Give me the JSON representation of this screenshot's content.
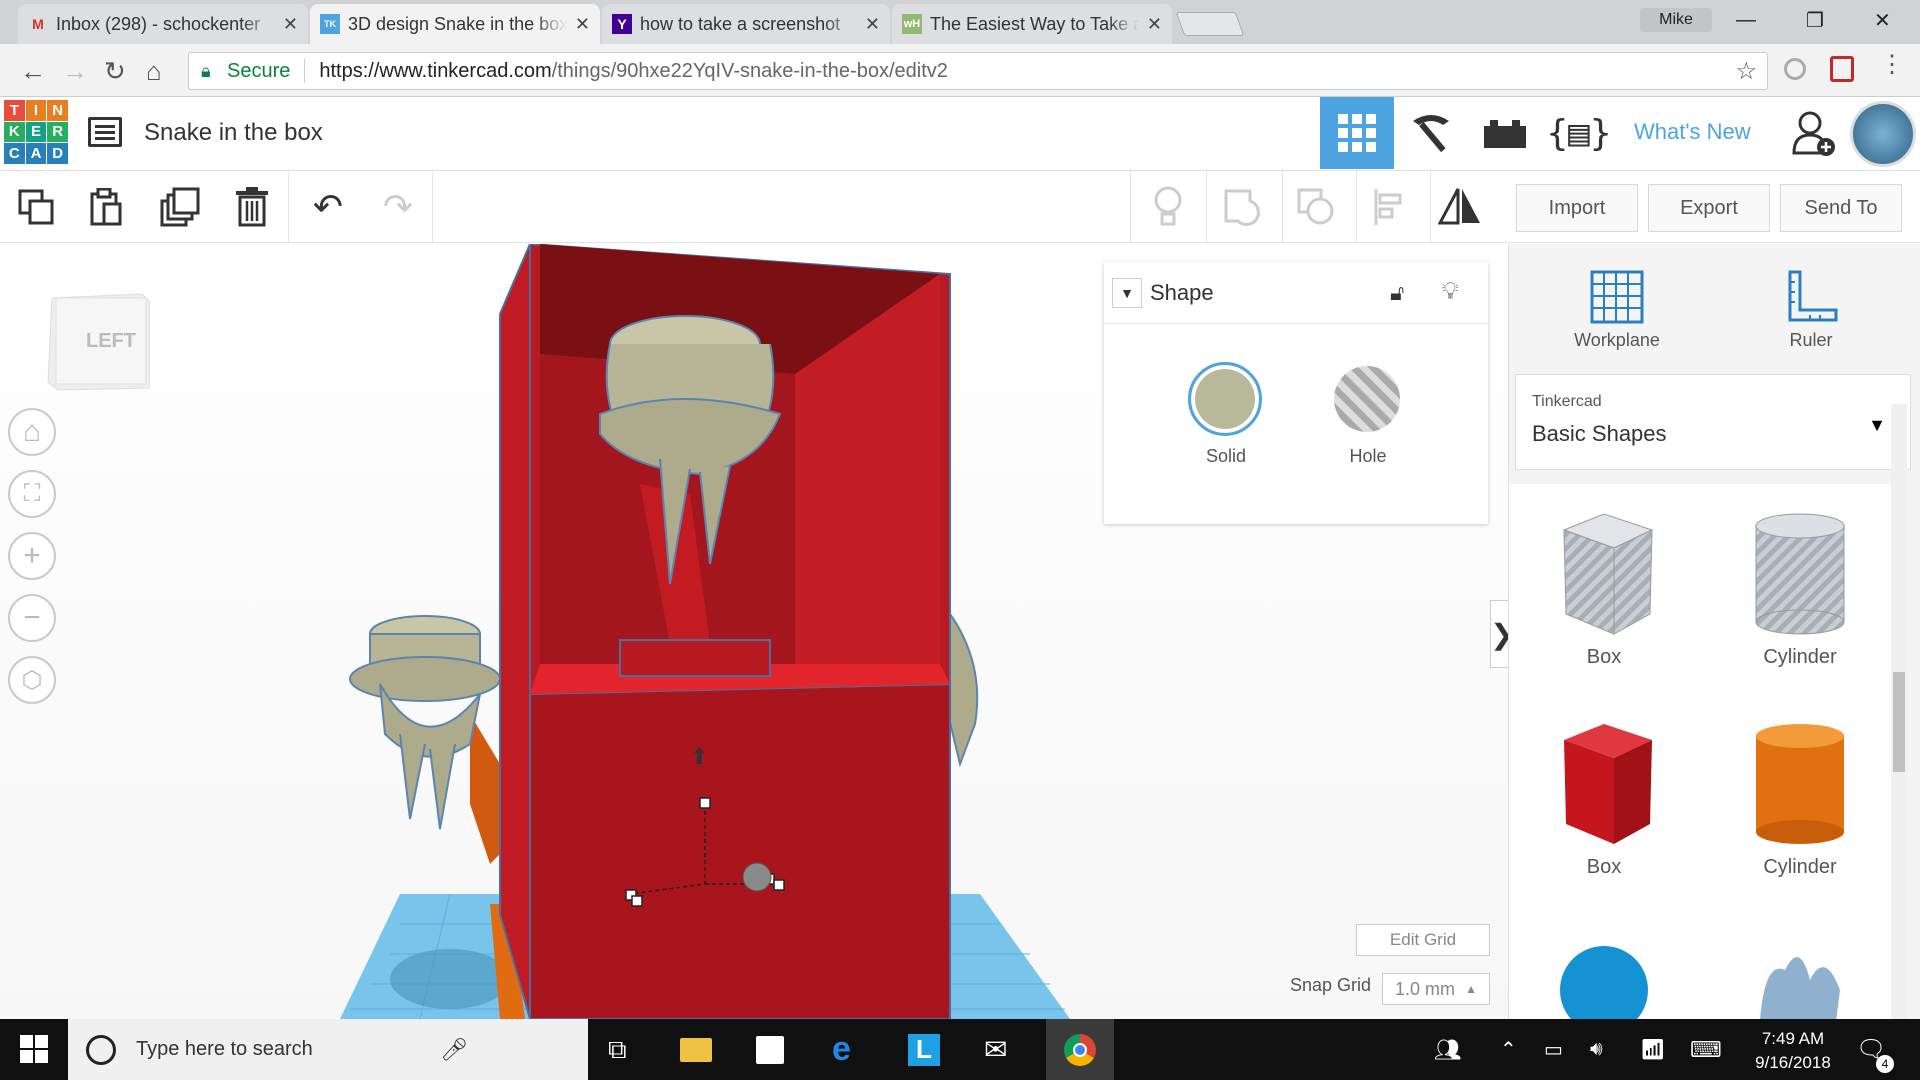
{
  "browser": {
    "tabs": [
      {
        "title": "Inbox (298) - schockenter",
        "icon": "gmail-icon",
        "color": "#d93025"
      },
      {
        "title": "3D design Snake in the box",
        "icon": "tinkercad-icon",
        "color": "#4ea3e1"
      },
      {
        "title": "how to take a screenshot",
        "icon": "yahoo-icon",
        "color": "#410093"
      },
      {
        "title": "The Easiest Way to Take a",
        "icon": "wikihow-icon",
        "color": "#93b874"
      }
    ],
    "profile": "Mike",
    "secure_label": "Secure",
    "url_host": "https://www.tinkercad.com",
    "url_path": "/things/90hxe22YqIV-snake-in-the-box/editv2"
  },
  "app": {
    "logo_letters": [
      "T",
      "I",
      "N",
      "K",
      "E",
      "R",
      "C",
      "A",
      "D"
    ],
    "logo_colors": [
      "#e74c3c",
      "#e67e22",
      "#f1c40f",
      "#27ae60",
      "#16a085",
      "#2980b9",
      "#8e44ad",
      "#2c3e50",
      "#3498db"
    ],
    "design_title": "Snake in the box",
    "whats_new": "What's New"
  },
  "toolbar": {
    "import": "Import",
    "export": "Export",
    "send_to": "Send To"
  },
  "viewport": {
    "viewcube_face": "LEFT"
  },
  "shape_panel": {
    "title": "Shape",
    "solid": "Solid",
    "hole": "Hole",
    "solid_color": "#b8b89a"
  },
  "grid": {
    "edit_grid": "Edit Grid",
    "snap_label": "Snap Grid",
    "snap_value": "1.0 mm"
  },
  "right_panel": {
    "workplane": "Workplane",
    "ruler": "Ruler",
    "library_small": "Tinkercad",
    "library_name": "Basic Shapes",
    "shapes": [
      {
        "label": "Box",
        "kind": "hole-box"
      },
      {
        "label": "Cylinder",
        "kind": "hole-cylinder"
      },
      {
        "label": "Box",
        "kind": "box"
      },
      {
        "label": "Cylinder",
        "kind": "cylinder"
      }
    ]
  },
  "taskbar": {
    "search_placeholder": "Type here to search",
    "time": "7:49 AM",
    "date": "9/16/2018",
    "notifications": "4"
  }
}
